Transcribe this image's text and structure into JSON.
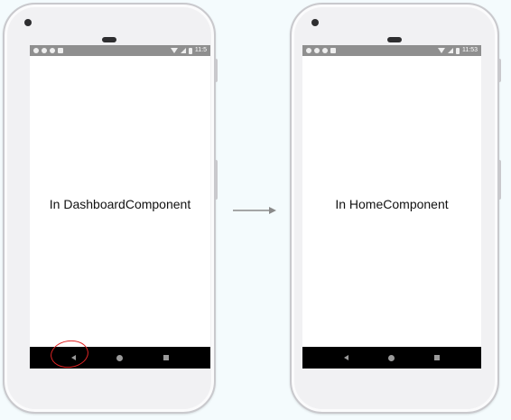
{
  "left_phone": {
    "status_time": "11:5",
    "content_text": "In DashboardComponent",
    "nav": {
      "back_icon": "back-triangle-icon",
      "home_icon": "home-circle-icon",
      "recents_icon": "recents-square-icon"
    }
  },
  "right_phone": {
    "status_time": "11:53",
    "content_text": "In HomeComponent",
    "nav": {
      "back_icon": "back-triangle-icon",
      "home_icon": "home-circle-icon",
      "recents_icon": "recents-square-icon"
    }
  },
  "highlight": {
    "target": "back-button",
    "color": "#e02424"
  },
  "transition": {
    "icon": "arrow-right-icon",
    "color": "#8a8a8a"
  }
}
